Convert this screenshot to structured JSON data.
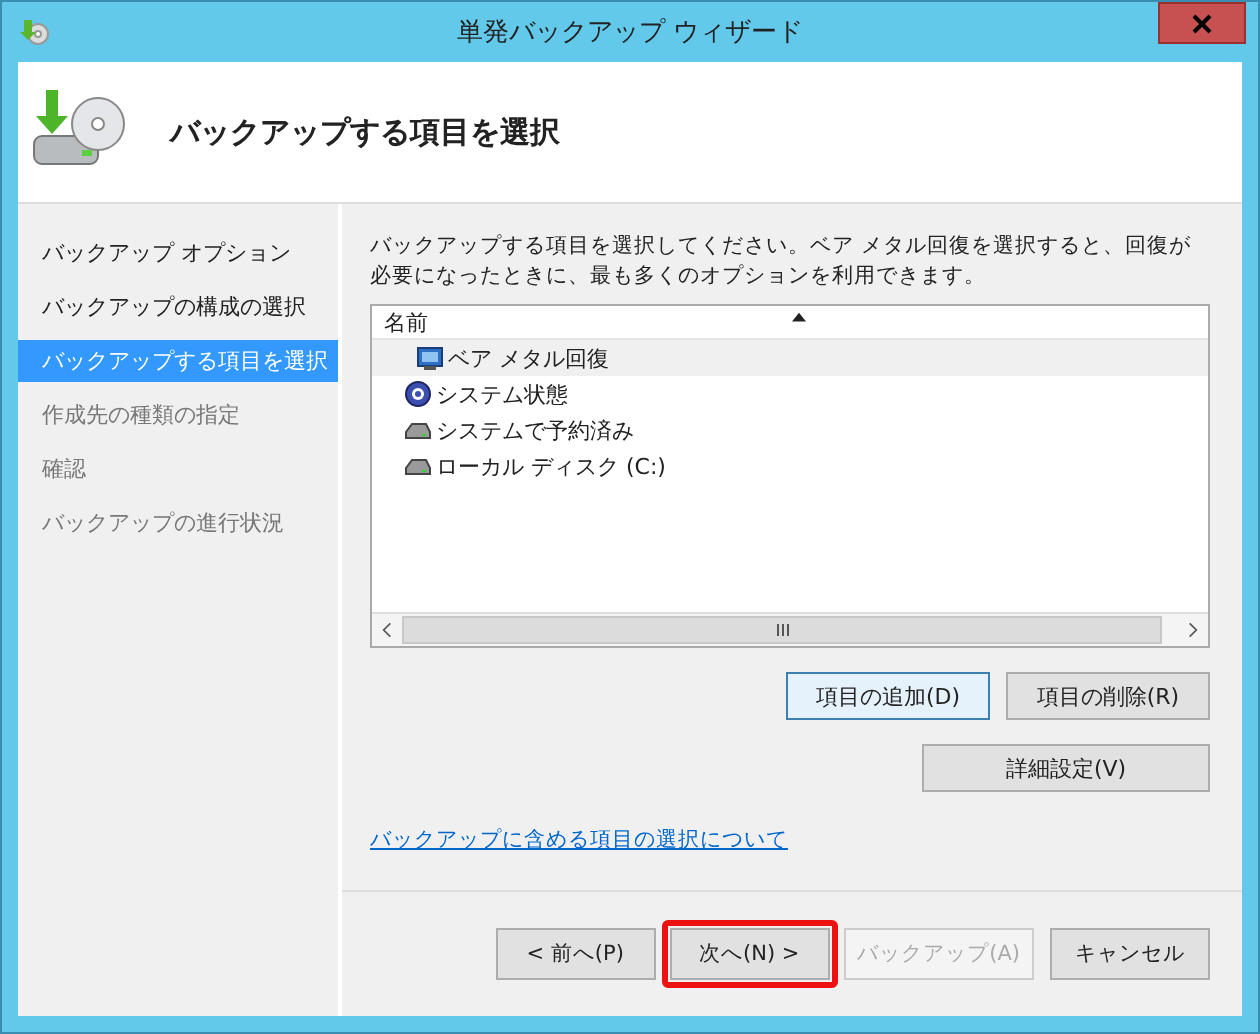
{
  "window": {
    "title": "単発バックアップ ウィザード"
  },
  "header": {
    "title": "バックアップする項目を選択"
  },
  "steps": [
    {
      "label": "バックアップ オプション",
      "selected": false,
      "completed": true
    },
    {
      "label": "バックアップの構成の選択",
      "selected": false,
      "completed": true
    },
    {
      "label": "バックアップする項目を選択",
      "selected": true,
      "completed": false
    },
    {
      "label": "作成先の種類の指定",
      "selected": false,
      "completed": false
    },
    {
      "label": "確認",
      "selected": false,
      "completed": false
    },
    {
      "label": "バックアップの進行状況",
      "selected": false,
      "completed": false
    }
  ],
  "description": "バックアップする項目を選択してください。ベア メタル回復を選択すると、回復が必要になったときに、最も多くのオプションを利用できます。",
  "list": {
    "column": "名前",
    "items": [
      {
        "label": "ベア メタル回復",
        "kind": "recovery",
        "selected": true
      },
      {
        "label": "システム状態",
        "kind": "system",
        "selected": false
      },
      {
        "label": "システムで予約済み",
        "kind": "drive",
        "selected": false
      },
      {
        "label": "ローカル ディスク (C:)",
        "kind": "drive",
        "selected": false
      }
    ]
  },
  "item_buttons": [
    {
      "label": "項目の追加(D)",
      "disabled": false
    },
    {
      "label": "項目の削除(R)",
      "disabled": false
    }
  ],
  "advanced_button": {
    "label": "詳細設定(V)",
    "disabled": false
  },
  "help_link": "バックアップに含める項目の選択について",
  "footer_buttons": [
    {
      "label": "< 前へ(P)",
      "disabled": false,
      "highlighted": false
    },
    {
      "label": "次へ(N) >",
      "disabled": false,
      "highlighted": true
    },
    {
      "label": "バックアップ(A)",
      "disabled": true,
      "highlighted": false
    },
    {
      "label": "キャンセル",
      "disabled": false,
      "highlighted": false
    }
  ]
}
